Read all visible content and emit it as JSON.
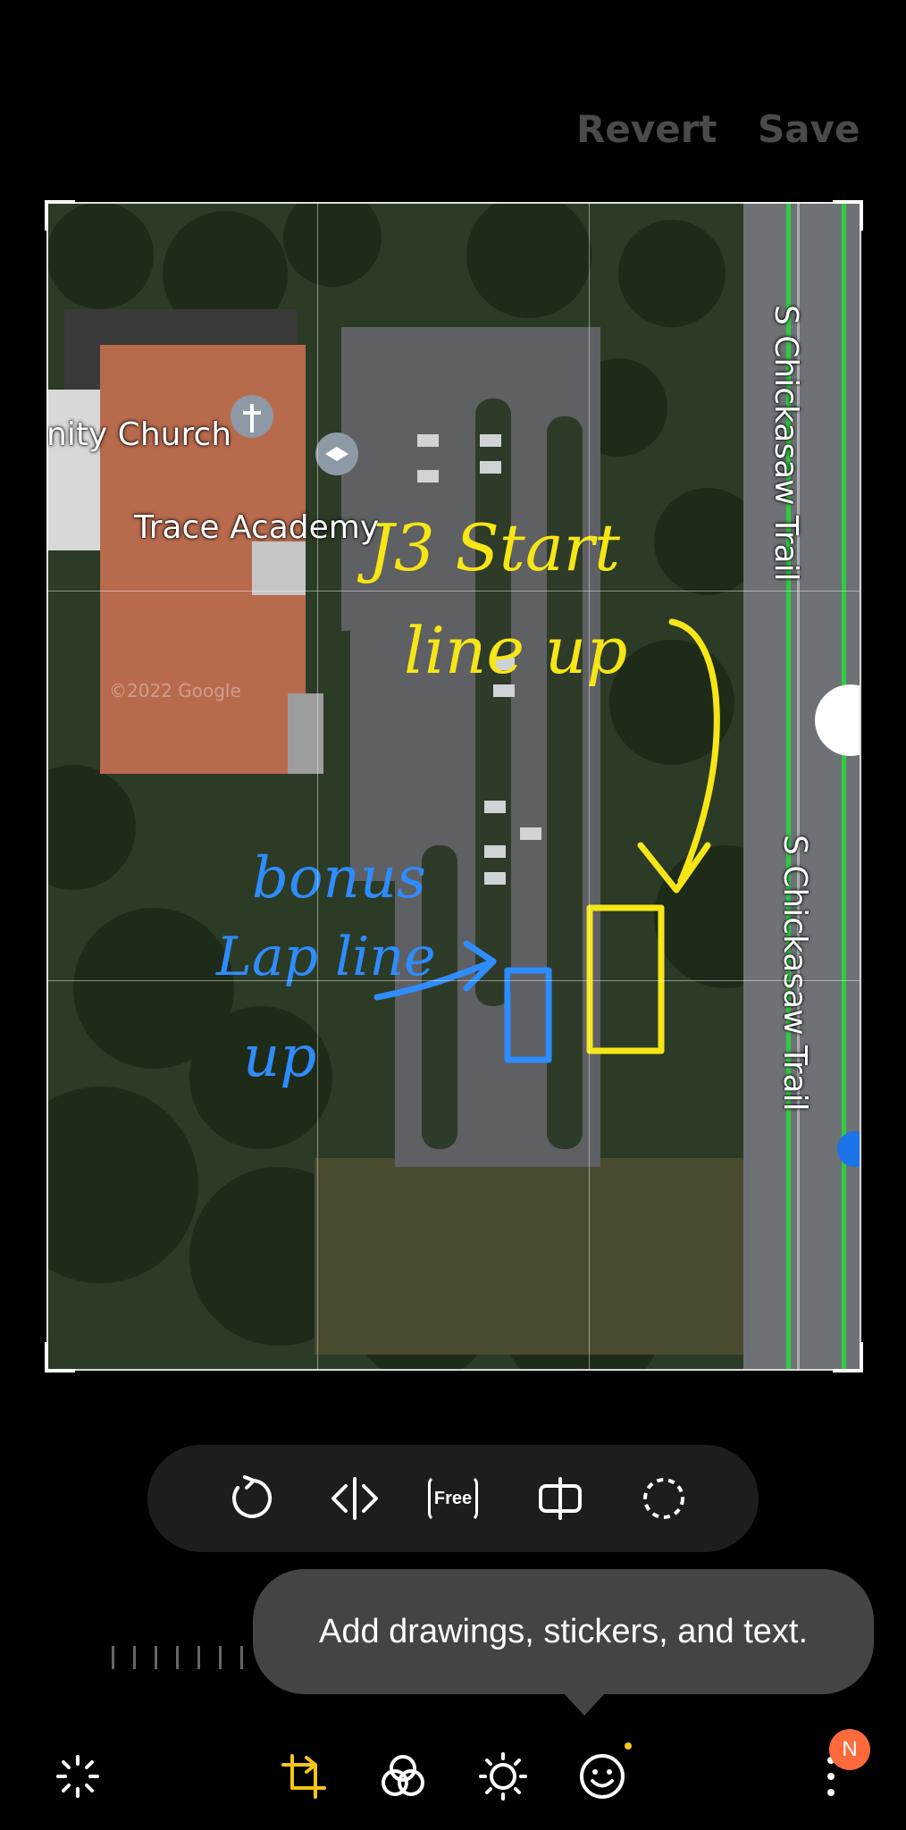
{
  "header": {
    "revert_label": "Revert",
    "save_label": "Save"
  },
  "photo": {
    "map_labels": {
      "church": "nity Church",
      "academy": "Trace Academy",
      "road_top": "S Chickasaw Trail",
      "road_bottom": "S Chickasaw Trail",
      "watermark": "©2022 Google"
    },
    "annotations": {
      "yellow_line1": "J3 Start",
      "yellow_line2": "line up",
      "blue_line1": "bonus",
      "blue_line2": "Lap line",
      "blue_line3": "up"
    }
  },
  "edit_tools": {
    "free_label": "Free",
    "icons": [
      "rotate-icon",
      "flip-icon",
      "free-aspect-icon",
      "perspective-icon",
      "lasso-icon"
    ]
  },
  "tooltip": {
    "text": "Add drawings, stickers, and text."
  },
  "bottom_bar": {
    "icons": [
      "auto-enhance-icon",
      "transform-icon",
      "filters-icon",
      "adjust-icon",
      "decorate-icon",
      "more-icon"
    ],
    "badge": "N"
  },
  "colors": {
    "accent": "#f5c518",
    "yellow_ink": "#f7e616",
    "blue_ink": "#2f8cff",
    "road_line": "#2ecc40"
  }
}
